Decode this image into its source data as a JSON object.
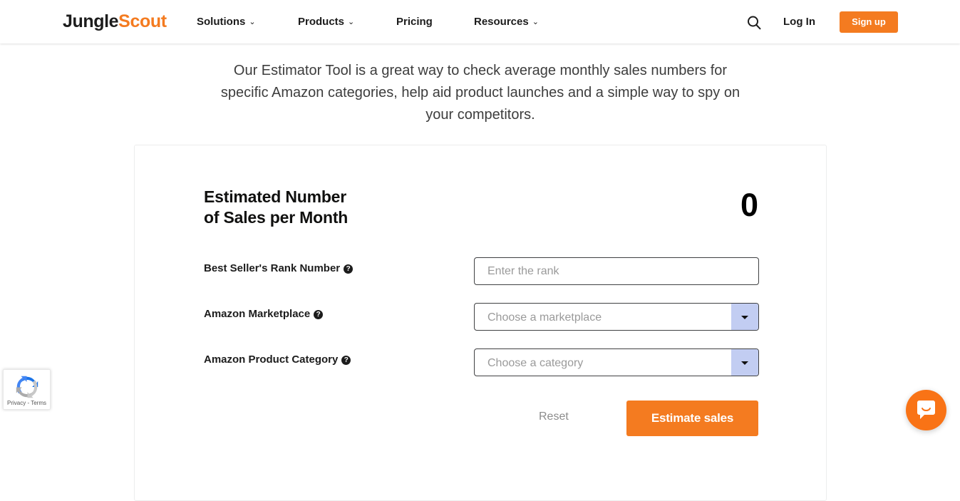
{
  "header": {
    "logo": {
      "part1": "Jungle",
      "part2": "Scout"
    },
    "nav": [
      {
        "label": "Solutions",
        "has_dropdown": true
      },
      {
        "label": "Products",
        "has_dropdown": true
      },
      {
        "label": "Pricing",
        "has_dropdown": false
      },
      {
        "label": "Resources",
        "has_dropdown": true
      }
    ],
    "search_icon": "search-icon",
    "login_label": "Log In",
    "signup_label": "Sign up",
    "chevron_glyph": "⌄",
    "accent_color": "#f47b20"
  },
  "intro": {
    "text": "Our Estimator Tool is a great way to check average monthly sales numbers for specific Amazon categories, help aid product launches and a simple way to spy on your competitors."
  },
  "estimator": {
    "result_title_line1": "Estimated Number",
    "result_title_line2": "of Sales per Month",
    "result_value": "0",
    "fields": [
      {
        "label": "Best Seller's Rank Number",
        "help_glyph": "?",
        "type": "text",
        "value": "",
        "placeholder": "Enter the rank"
      },
      {
        "label": "Amazon Marketplace",
        "help_glyph": "?",
        "type": "select",
        "value": "Choose a marketplace"
      },
      {
        "label": "Amazon Product Category",
        "help_glyph": "?",
        "type": "select",
        "value": "Choose a category"
      }
    ],
    "reset_label": "Reset",
    "submit_label": "Estimate sales"
  },
  "recaptcha": {
    "text": "Privacy - Terms"
  },
  "chat": {
    "icon": "chat-bubble-icon"
  }
}
